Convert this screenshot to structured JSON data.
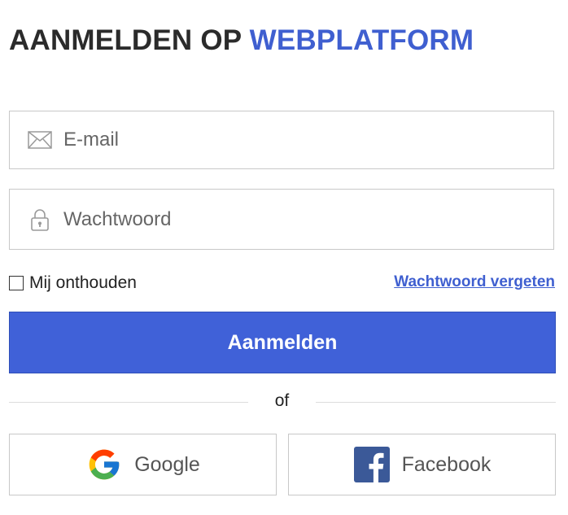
{
  "header": {
    "title_part1": "AANMELDEN OP ",
    "title_part2": "WEBPLATFORM",
    "accent_color": "#3f5fd0"
  },
  "form": {
    "email": {
      "placeholder": "E-mail",
      "value": "",
      "icon": "envelope-icon"
    },
    "password": {
      "placeholder": "Wachtwoord",
      "value": "",
      "icon": "lock-icon"
    },
    "remember_label": "Mij onthouden",
    "remember_checked": false,
    "forgot_link": "Wachtwoord vergeten",
    "submit_label": "Aanmelden",
    "submit_color": "#4061d8"
  },
  "divider": {
    "text": "of"
  },
  "social": {
    "google_label": "Google",
    "google_icon": "google-logo-icon",
    "facebook_label": "Facebook",
    "facebook_icon": "facebook-logo-icon",
    "facebook_color": "#3b5998"
  }
}
